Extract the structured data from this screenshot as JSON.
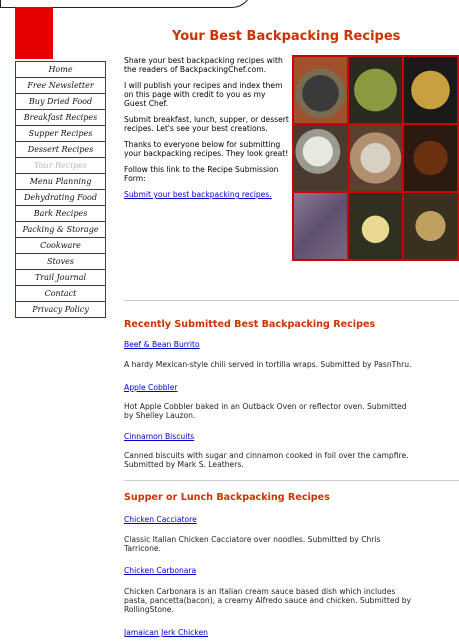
{
  "page": {
    "title": "Your Best Backpacking Recipes"
  },
  "sidebar": {
    "items": [
      {
        "label": "Home"
      },
      {
        "label": "Free Newsletter"
      },
      {
        "label": "Buy Dried Food"
      },
      {
        "label": "Breakfast Recipes"
      },
      {
        "label": "Supper Recipes"
      },
      {
        "label": "Dessert Recipes"
      },
      {
        "label": "Your Recipes"
      },
      {
        "label": "Menu Planning"
      },
      {
        "label": "Dehydrating Food"
      },
      {
        "label": "Bark Recipes"
      },
      {
        "label": "Packing & Storage"
      },
      {
        "label": "Cookware"
      },
      {
        "label": "Stoves"
      },
      {
        "label": "Trail Journal"
      },
      {
        "label": "Contact"
      },
      {
        "label": "Privacy Policy"
      }
    ]
  },
  "intro": {
    "p1": "Share your best backpacking recipes with the readers of BackpackingChef.com.",
    "p2": "I will publish your recipes and index them on this page with credit to you as my Guest Chef.",
    "p3": "Submit breakfast, lunch, supper, or dessert recipes. Let's see your best creations.",
    "p4": "Thanks to everyone below for submitting your backpacking recipes. They look great!",
    "p5": "Follow this link to the Recipe Submission Form:",
    "link": "Submit your best backpacking recipes."
  },
  "sections": {
    "recent": {
      "title": "Recently Submitted Best Backpacking Recipes",
      "recipes": [
        {
          "name": "Beef & Bean Burrito",
          "desc": "A hardy Mexican-style chili served in tortilla wraps. Submitted by PasnThru."
        },
        {
          "name": "Apple Cobbler",
          "desc1": "Hot Apple Cobbler baked in an Outback Oven or reflector oven. Submitted",
          "desc2": "by Shelley Lauzon."
        },
        {
          "name": "Cinnamon Biscuits",
          "desc1": "Canned biscuits with sugar and cinnamon cooked in foil over the campfire.",
          "desc2": "Submitted by Mark S. Leathers."
        }
      ]
    },
    "supper": {
      "title": "Supper or Lunch Backpacking Recipes",
      "recipes": [
        {
          "name": "Chicken Cacciatore",
          "desc1": "Classic Italian Chicken Cacciatore over noodles. Submitted by Chris",
          "desc2": "Tarricone."
        },
        {
          "name": "Chicken Carbonara",
          "desc1": "Chicken Carbonara is an Italian cream sauce based dish which includes",
          "desc2": "pasta, pancetta(bacon), a creamy Alfredo sauce and chicken. Submitted by",
          "desc3": "RollingStone."
        },
        {
          "name": "Jamaican Jerk Chicken"
        }
      ]
    }
  },
  "colors": {
    "accent": "#cc3300",
    "nav_border": "#cc0000",
    "link": "#0000cc"
  }
}
